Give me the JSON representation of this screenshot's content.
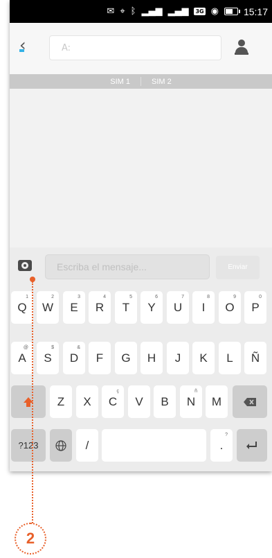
{
  "status_bar": {
    "time": "15:17",
    "network_badge": "3G"
  },
  "header": {
    "to_label": "A:"
  },
  "sim_bar": {
    "sim1": "SIM 1",
    "sim2": "SIM 2"
  },
  "compose": {
    "placeholder": "Escriba el mensaje...",
    "send_label": "Enviar"
  },
  "keyboard": {
    "row1": [
      {
        "k": "Q",
        "alt": "1"
      },
      {
        "k": "W",
        "alt": "2"
      },
      {
        "k": "E",
        "alt": "3"
      },
      {
        "k": "R",
        "alt": "4"
      },
      {
        "k": "T",
        "alt": "5"
      },
      {
        "k": "Y",
        "alt": "6"
      },
      {
        "k": "U",
        "alt": "7"
      },
      {
        "k": "I",
        "alt": "8"
      },
      {
        "k": "O",
        "alt": "9"
      },
      {
        "k": "P",
        "alt": "0"
      }
    ],
    "row2": [
      {
        "k": "A",
        "alt": "@"
      },
      {
        "k": "S",
        "alt": "$"
      },
      {
        "k": "D",
        "alt": "&"
      },
      {
        "k": "F",
        "alt": ""
      },
      {
        "k": "G",
        "alt": ""
      },
      {
        "k": "H",
        "alt": ""
      },
      {
        "k": "J",
        "alt": ""
      },
      {
        "k": "K",
        "alt": ""
      },
      {
        "k": "L",
        "alt": ""
      },
      {
        "k": "Ñ",
        "alt": ""
      }
    ],
    "row3": [
      {
        "k": "Z",
        "alt": ""
      },
      {
        "k": "X",
        "alt": ""
      },
      {
        "k": "C",
        "alt": "ç"
      },
      {
        "k": "V",
        "alt": ""
      },
      {
        "k": "B",
        "alt": ""
      },
      {
        "k": "N",
        "alt": "ñ"
      },
      {
        "k": "M",
        "alt": ""
      }
    ],
    "symbols_label": "?123",
    "slash_label": "/",
    "period_label": ".",
    "period_alt": "?"
  },
  "annotation": {
    "step_number": "2",
    "color": "#e8602a"
  }
}
